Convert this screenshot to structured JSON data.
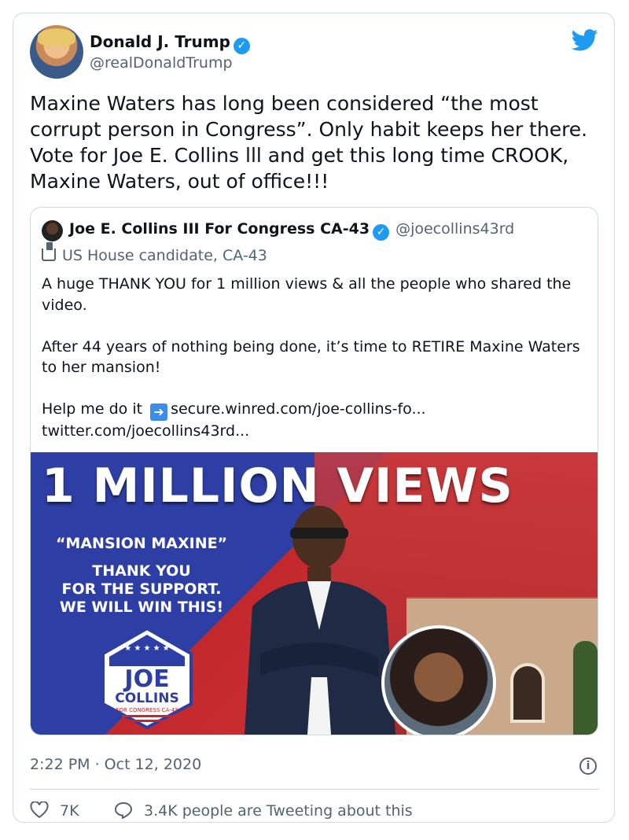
{
  "tweet": {
    "author_name": "Donald J. Trump",
    "author_handle": "@realDonaldTrump",
    "text": "Maxine Waters has long been considered “the most corrupt person in Congress”. Only habit keeps her there. Vote for Joe E. Collins lll and get this long time CROOK, Maxine Waters, out of office!!!",
    "timestamp": "2:22 PM · Oct 12, 2020",
    "likes": "7K",
    "replies_label": "3.4K people are Tweeting about this"
  },
  "quoted_tweet": {
    "author_name": "Joe E. Collins III For Congress CA-43",
    "author_handle": "@joecollins43rd",
    "label": "US House candidate, CA-43",
    "text_part1": "A huge THANK YOU for 1 million views & all the people who shared the video.\n\nAfter 44 years of nothing being done, it’s time to RETIRE Maxine Waters to her mansion!\n\nHelp me do it",
    "link1": "secure.winred.com/joe-collins-fo...",
    "link2": "twitter.com/joecollins43rd..."
  },
  "media": {
    "headline": "1 MILLION VIEWS",
    "tagline": "“MANSION MAXINE”",
    "message_line1": "THANK YOU",
    "message_line2": "FOR THE SUPPORT.",
    "message_line3": "WE WILL WIN THIS!",
    "logo_line1": "JOE",
    "logo_line2": "COLLINS",
    "logo_line3": "FOR CONGRESS CA-43"
  },
  "colors": {
    "verified": "#1d9bf0",
    "twitter_blue": "#1d9bf0",
    "muted_text": "#536471",
    "border": "#cfd9de"
  },
  "icons": [
    "verified-icon",
    "twitter-bird-icon",
    "ballot-box-icon",
    "right-arrow-icon",
    "info-icon",
    "heart-icon",
    "reply-icon"
  ]
}
